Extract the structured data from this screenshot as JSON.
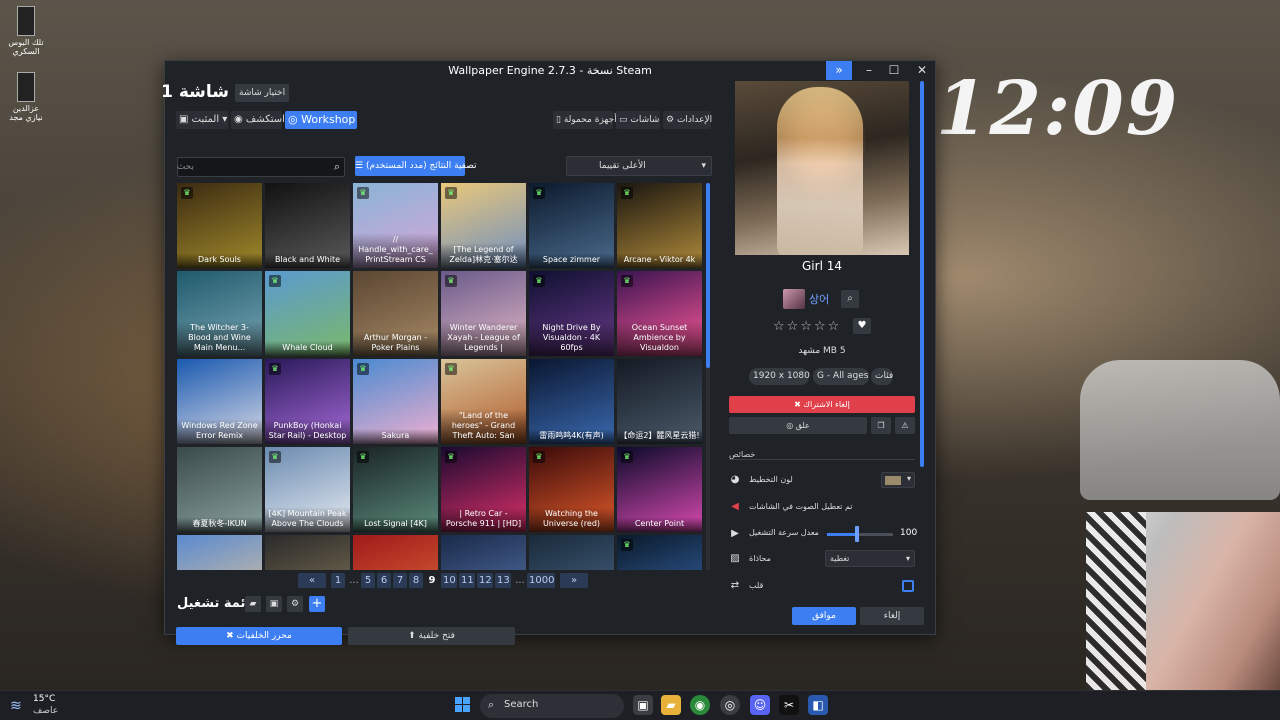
{
  "desktop": {
    "clock": "12:09",
    "icons": [
      {
        "label": "تلك البوس السكري"
      },
      {
        "label": "عزالدين نيازي مجد"
      }
    ]
  },
  "window": {
    "title": "Wallpaper Engine 2.7.3 - نسخة Steam",
    "screen_title": "شاشة 1",
    "choose_screen": "اختيار شاشة",
    "tabs": {
      "installed": "المثبت",
      "discover": "استكشف",
      "workshop": "Workshop"
    },
    "top_buttons": {
      "mobile": "أجهزة محمولة",
      "screens": "شاشات",
      "settings": "الإعدادات"
    },
    "search_placeholder": "بحث",
    "filter_button": "تصفية النتائج (مدد المستخدم)",
    "sort_value": "الأعلى تقييما",
    "wallpapers": [
      {
        "title": "Dark Souls",
        "badge": "trophy",
        "c1": "#3b2a12",
        "c2": "#a08a2a"
      },
      {
        "title": "Black and White",
        "badge": "",
        "c1": "#111111",
        "c2": "#5a5a5a"
      },
      {
        "title": "// Handle_with_care_ PrintStream CS",
        "badge": "trophy",
        "c1": "#8ab4d6",
        "c2": "#d7a6d9"
      },
      {
        "title": "[The Legend of Zelda]林克·塞尔达",
        "badge": "trophy",
        "c1": "#e9c77a",
        "c2": "#6f8fc0"
      },
      {
        "title": "Space zimmer",
        "badge": "trophy",
        "c1": "#0c1a2c",
        "c2": "#4a6b8e"
      },
      {
        "title": "Arcane - Viktor 4k",
        "badge": "trophy",
        "c1": "#1a1610",
        "c2": "#b08a3a"
      },
      {
        "title": "The Witcher 3- Blood and Wine Main Menu...",
        "badge": "",
        "c1": "#1f5a6c",
        "c2": "#7aa7b5"
      },
      {
        "title": "Whale Cloud",
        "badge": "trophy",
        "c1": "#5a9ad0",
        "c2": "#7bb86a"
      },
      {
        "title": "Arthur Morgan - Poker Plains",
        "badge": "",
        "c1": "#5a4632",
        "c2": "#a88a66"
      },
      {
        "title": "Winter Wanderer Xayah - League of Legends |",
        "badge": "trophy",
        "c1": "#6a5a8a",
        "c2": "#e2b8c6"
      },
      {
        "title": "Night Drive By Visualdon - 4K 60fps",
        "badge": "trophy",
        "c1": "#0e1030",
        "c2": "#6a3a8a"
      },
      {
        "title": "Ocean Sunset Ambience by Visualdon",
        "badge": "trophy",
        "c1": "#3a1450",
        "c2": "#ff5a9a"
      },
      {
        "title": "Windows Red Zone Error Remix",
        "badge": "",
        "c1": "#1a5ab0",
        "c2": "#d9d9e6"
      },
      {
        "title": "PunkBoy (Honkai Star Rail) - Desktop",
        "badge": "trophy",
        "c1": "#2a1a5a",
        "c2": "#a66ad9"
      },
      {
        "title": "Sakura",
        "badge": "trophy",
        "c1": "#4a8ad0",
        "c2": "#f0b0d0"
      },
      {
        "title": "\"Land of the heroes\" - Grand Theft Auto: San",
        "badge": "trophy",
        "c1": "#d9c49a",
        "c2": "#b05a2a"
      },
      {
        "title": "雷雨鸣鸣4K(有声)",
        "badge": "",
        "c1": "#0a1630",
        "c2": "#3a6ab0"
      },
      {
        "title": "【命运2】麓风星云猎!",
        "badge": "",
        "c1": "#141a24",
        "c2": "#4a5a6a"
      },
      {
        "title": "春夏秋冬-IKUN",
        "badge": "",
        "c1": "#3a4a4a",
        "c2": "#8aa0a0"
      },
      {
        "title": "[4K] Mountain Peak Above The Clouds",
        "badge": "trophy",
        "c1": "#6a8ab0",
        "c2": "#e6ecf2"
      },
      {
        "title": "Lost Signal [4K]",
        "badge": "trophy",
        "c1": "#1a2424",
        "c2": "#5a8a7a"
      },
      {
        "title": "| Retro Car - Porsche 911 | [HD]",
        "badge": "trophy",
        "c1": "#1a0a30",
        "c2": "#e0306a"
      },
      {
        "title": "Watching the Universe (red)",
        "badge": "trophy",
        "c1": "#3a0a0a",
        "c2": "#e05a2a"
      },
      {
        "title": "Center Point",
        "badge": "trophy",
        "c1": "#0a0a2a",
        "c2": "#d94ab0"
      },
      {
        "title": "",
        "badge": "",
        "c1": "#5a8ad0",
        "c2": "#e6c89a"
      },
      {
        "title": "",
        "badge": "",
        "c1": "#2a2a2a",
        "c2": "#8a7a5a"
      },
      {
        "title": "",
        "badge": "",
        "c1": "#a01a1a",
        "c2": "#e06a3a"
      },
      {
        "title": "",
        "badge": "",
        "c1": "#1a2a4a",
        "c2": "#5a7ab0"
      },
      {
        "title": "",
        "badge": "",
        "c1": "#1a2a3a",
        "c2": "#4a6a8a"
      },
      {
        "title": "",
        "badge": "trophy",
        "c1": "#0a1a2a",
        "c2": "#3a6ab0"
      }
    ],
    "pagination": {
      "pages": [
        "1",
        "...",
        "5",
        "6",
        "7",
        "8",
        "9",
        "10",
        "11",
        "12",
        "13",
        "...",
        "1000"
      ],
      "current": "9"
    },
    "playlist_title": "قائمة تشغيل",
    "bottom_buttons": {
      "editor": "محرر الخلفيات",
      "open_wallpaper": "فتح خلفية"
    },
    "selected": {
      "title": "Girl 14",
      "author": "상어",
      "rating_stars": "☆☆☆☆☆",
      "size": "5 MB مشهد",
      "resolution": "1920 x 1080",
      "age_rating": "G - All ages",
      "tags": "فئات",
      "unsubscribe": "إلغاء الاشتراك",
      "comment": "علق",
      "section_properties": "خصائص",
      "props": {
        "scheme_color": "لون التخطيط",
        "audio": "تم تعطيل الصوت في الشاشات",
        "playback_rate": "معدل سرعة التشغيل",
        "playback_value": "100",
        "alignment": "محاذاة",
        "alignment_value": "تغطية",
        "flip": "قلب"
      },
      "ok": "موافق",
      "cancel": "إلغاء"
    }
  },
  "taskbar": {
    "temperature": "15°C",
    "weather": "عاصف",
    "search": "Search"
  },
  "colors": {
    "accent": "#3d7ff2",
    "danger": "#e0404a",
    "panel": "#1f2328"
  }
}
